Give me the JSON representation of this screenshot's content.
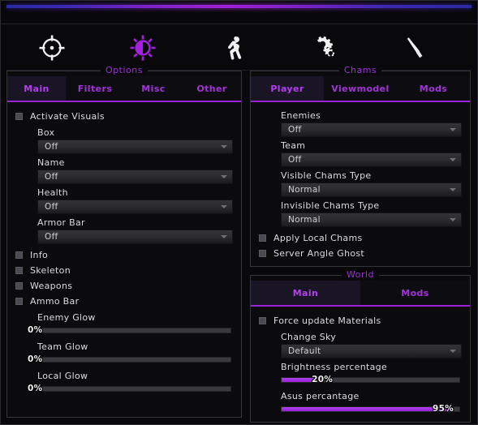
{
  "window": {
    "title": ""
  },
  "nav": {
    "items": [
      {
        "icon": "crosshair-icon",
        "name": "nav-aimbot",
        "active": false
      },
      {
        "icon": "brightness-sun-icon",
        "name": "nav-visuals",
        "active": true
      },
      {
        "icon": "player-silhouette-icon",
        "name": "nav-player",
        "active": false
      },
      {
        "icon": "gears-icon",
        "name": "nav-settings",
        "active": false
      },
      {
        "icon": "knife-icon",
        "name": "nav-skins",
        "active": false
      }
    ]
  },
  "options": {
    "legend": "Options",
    "tabs": [
      {
        "label": "Main",
        "active": true
      },
      {
        "label": "Filters",
        "active": false
      },
      {
        "label": "Misc",
        "active": false
      },
      {
        "label": "Other",
        "active": false
      }
    ],
    "activate_visuals": "Activate Visuals",
    "combos": [
      {
        "label": "Box",
        "value": "Off"
      },
      {
        "label": "Name",
        "value": "Off"
      },
      {
        "label": "Health",
        "value": "Off"
      },
      {
        "label": "Armor Bar",
        "value": "Off"
      }
    ],
    "checks": [
      {
        "label": "Info"
      },
      {
        "label": "Skeleton"
      },
      {
        "label": "Weapons"
      },
      {
        "label": "Ammo Bar"
      }
    ],
    "sliders": [
      {
        "label": "Enemy Glow",
        "value": 0,
        "display": "0%"
      },
      {
        "label": "Team Glow",
        "value": 0,
        "display": "0%"
      },
      {
        "label": "Local Glow",
        "value": 0,
        "display": "0%"
      }
    ]
  },
  "chams": {
    "legend": "Chams",
    "tabs": [
      {
        "label": "Player",
        "active": true
      },
      {
        "label": "Viewmodel",
        "active": false
      },
      {
        "label": "Mods",
        "active": false
      }
    ],
    "combos": [
      {
        "label": "Enemies",
        "value": "Off"
      },
      {
        "label": "Team",
        "value": "Off"
      },
      {
        "label": "Visible Chams Type",
        "value": "Normal"
      },
      {
        "label": "Invisible Chams Type",
        "value": "Normal"
      }
    ],
    "checks": [
      {
        "label": "Apply Local Chams"
      },
      {
        "label": "Server Angle Ghost"
      }
    ]
  },
  "world": {
    "legend": "World",
    "tabs": [
      {
        "label": "Main",
        "active": true
      },
      {
        "label": "Mods",
        "active": false
      }
    ],
    "checks": [
      {
        "label": "Force update Materials"
      }
    ],
    "combos": [
      {
        "label": "Change Sky",
        "value": "Default"
      }
    ],
    "sliders": [
      {
        "label": "Brightness percentage",
        "value": 20,
        "display": "20%"
      },
      {
        "label": "Asus percantage",
        "value": 95,
        "display": "95%"
      }
    ]
  },
  "colors": {
    "accent": "#9b22d6",
    "accent_bright": "#b43ff0",
    "background": "#09090b",
    "panel_border": "#34343c",
    "text": "#dcdcdc"
  }
}
